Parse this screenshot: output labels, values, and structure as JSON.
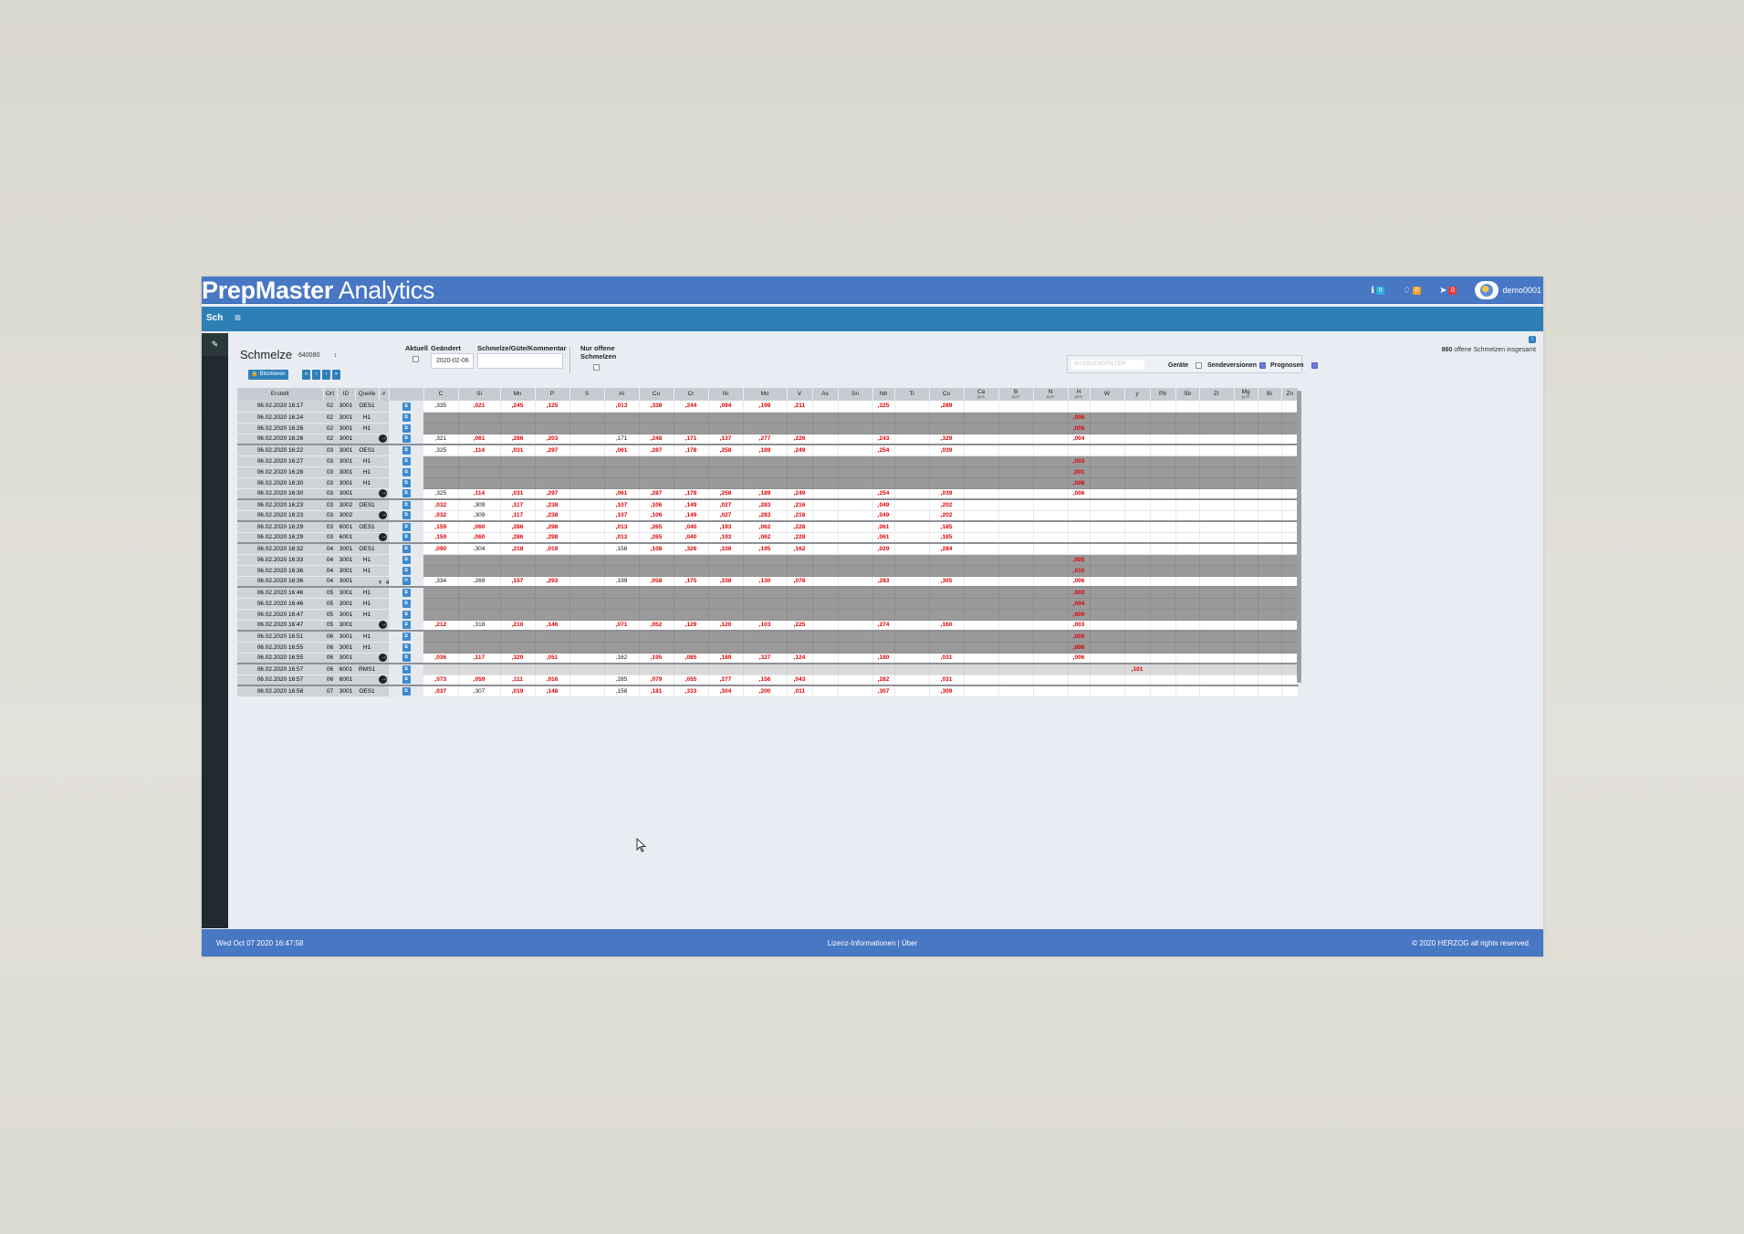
{
  "app": {
    "brand_bold": "PrepMaster",
    "brand_light": "Analytics"
  },
  "header": {
    "info_count": "0",
    "bell_count": "0",
    "alert_count": "0",
    "user": "demo0001"
  },
  "toolbar": {
    "tab": "Sch",
    "menu_icon": "≡"
  },
  "sidebar": {
    "button_icon": "✎"
  },
  "page": {
    "title": "Schmelze",
    "select_value": "640080",
    "block_button": "Blockieren",
    "pager": [
      "«",
      "‹",
      "›",
      "»"
    ],
    "aktuell": "Aktuell",
    "geaendert": "Geändert",
    "geaendert_value": "2020-02-06",
    "kommentar": "Schmelze/Güte/Kommentar",
    "nur_offene_1": "Nur offene",
    "nur_offene_2": "Schmelzen",
    "total_count": "860",
    "total_text": "offene Schmelzen insgesamt",
    "filter_placeholder": "AUSBLENDFILTER",
    "geraete": "Geräte",
    "sendeversionen": "Sendeversionen",
    "prognosen": "Prognosen"
  },
  "table": {
    "fixed_headers": [
      "Erstellt",
      "Ort",
      "ID",
      "Quelle",
      "#"
    ],
    "elements": [
      [
        "C",
        ""
      ],
      [
        "Si",
        ""
      ],
      [
        "Mn",
        ""
      ],
      [
        "P",
        ""
      ],
      [
        "S",
        ""
      ],
      [
        "Al",
        ""
      ],
      [
        "Cu",
        ""
      ],
      [
        "Cr",
        ""
      ],
      [
        "Ni",
        ""
      ],
      [
        "Mo",
        ""
      ],
      [
        "V",
        ""
      ],
      [
        "As",
        ""
      ],
      [
        "Sn",
        ""
      ],
      [
        "Nb",
        ""
      ],
      [
        "Ti",
        ""
      ],
      [
        "Co",
        ""
      ],
      [
        "Ca",
        "ppm"
      ],
      [
        "B",
        "ppm"
      ],
      [
        "N",
        "ppm"
      ],
      [
        "H",
        "ppm"
      ],
      [
        "W",
        ""
      ],
      [
        "y",
        ""
      ],
      [
        "Pb",
        ""
      ],
      [
        "Sb",
        ""
      ],
      [
        "Zr",
        ""
      ],
      [
        "Mg",
        "ppm"
      ],
      [
        "Bi",
        ""
      ],
      [
        "Zn",
        ""
      ]
    ],
    "rows": [
      {
        "d": "06.02.2020 16:17",
        "o": "02",
        "id": "3001",
        "q": "OES1",
        "n": "",
        "a": "",
        "t": "c",
        "v": {
          "0": ",335",
          "1": ",021",
          "2": ",245",
          "3": ",125",
          "5": ",013",
          "6": ",338",
          "7": ",244",
          "8": ",094",
          "9": ",199",
          "10": ",211",
          "13": ",325",
          "15": ",289"
        },
        "k": [
          0
        ]
      },
      {
        "d": "06.02.2020 16:24",
        "o": "02",
        "id": "3001",
        "q": "H1",
        "n": "",
        "a": "",
        "t": "g",
        "v": {
          "19": ",006"
        }
      },
      {
        "d": "06.02.2020 16:26",
        "o": "02",
        "id": "3001",
        "q": "H1",
        "n": "",
        "a": "",
        "t": "g",
        "v": {
          "19": ",005"
        }
      },
      {
        "d": "06.02.2020 16:26",
        "o": "02",
        "id": "3001",
        "q": "",
        "n": "4",
        "a": "arrow",
        "t": "c",
        "sep": true,
        "v": {
          "0": ",321",
          "1": ",061",
          "2": ",286",
          "3": ",203",
          "5": ",171",
          "6": ",248",
          "7": ",171",
          "8": ",137",
          "9": ",277",
          "10": ",226",
          "13": ",243",
          "15": ",329",
          "19": ",004"
        },
        "k": [
          0,
          5
        ]
      },
      {
        "d": "06.02.2020 16:22",
        "o": "03",
        "id": "3001",
        "q": "OES1",
        "n": "",
        "a": "",
        "t": "c",
        "v": {
          "0": ",325",
          "1": ",114",
          "2": ",031",
          "3": ",297",
          "5": ",061",
          "6": ",287",
          "7": ",178",
          "8": ",258",
          "9": ",189",
          "10": ",249",
          "13": ",254",
          "15": ",039"
        },
        "k": [
          0
        ]
      },
      {
        "d": "06.02.2020 16:27",
        "o": "03",
        "id": "3001",
        "q": "H1",
        "n": "",
        "a": "",
        "t": "g",
        "v": {
          "19": ",003"
        }
      },
      {
        "d": "06.02.2020 16:28",
        "o": "03",
        "id": "3001",
        "q": "H1",
        "n": "",
        "a": "",
        "t": "g",
        "v": {
          "19": ",001"
        }
      },
      {
        "d": "06.02.2020 16:30",
        "o": "03",
        "id": "3001",
        "q": "H1",
        "n": "",
        "a": "",
        "t": "g",
        "v": {
          "19": ",008"
        }
      },
      {
        "d": "06.02.2020 16:30",
        "o": "03",
        "id": "3001",
        "q": "",
        "n": "2",
        "a": "arrow",
        "t": "c",
        "sep": true,
        "v": {
          "0": ",325",
          "1": ",114",
          "2": ",031",
          "3": ",297",
          "5": ",061",
          "6": ",287",
          "7": ",178",
          "8": ",258",
          "9": ",189",
          "10": ",249",
          "13": ",254",
          "15": ",039",
          "19": ",006"
        },
        "k": [
          0
        ]
      },
      {
        "d": "06.02.2020 16:23",
        "o": "03",
        "id": "3002",
        "q": "OES1",
        "n": "",
        "a": "",
        "t": "c",
        "v": {
          "0": ",032",
          "1": ",309",
          "2": ",117",
          "3": ",238",
          "5": ",107",
          "6": ",106",
          "7": ",149",
          "8": ",027",
          "9": ",283",
          "10": ",216",
          "13": ",049",
          "15": ",202"
        },
        "k": [
          1
        ]
      },
      {
        "d": "06.02.2020 16:23",
        "o": "03",
        "id": "3002",
        "q": "",
        "n": "0",
        "a": "arrow",
        "t": "c",
        "sep": true,
        "v": {
          "0": ",032",
          "1": ",309",
          "2": ",117",
          "3": ",238",
          "5": ",107",
          "6": ",106",
          "7": ",149",
          "8": ",027",
          "9": ",283",
          "10": ",216",
          "13": ",049",
          "15": ",202"
        },
        "k": [
          1
        ]
      },
      {
        "d": "06.02.2020 16:29",
        "o": "03",
        "id": "6001",
        "q": "OES1",
        "n": "",
        "a": "",
        "t": "c",
        "v": {
          "0": ",159",
          "1": ",060",
          "2": ",286",
          "3": ",298",
          "5": ",013",
          "6": ",265",
          "7": ",040",
          "8": ",193",
          "9": ",062",
          "10": ",228",
          "13": ",061",
          "15": ",185"
        }
      },
      {
        "d": "06.02.2020 16:29",
        "o": "03",
        "id": "6001",
        "q": "",
        "n": "0",
        "a": "arrow",
        "t": "c",
        "sep": true,
        "v": {
          "0": ",159",
          "1": ",060",
          "2": ",286",
          "3": ",298",
          "5": ",013",
          "6": ",265",
          "7": ",040",
          "8": ",193",
          "9": ",062",
          "10": ",228",
          "13": ",061",
          "15": ",185"
        }
      },
      {
        "d": "06.02.2020 16:32",
        "o": "04",
        "id": "3001",
        "q": "OES1",
        "n": "",
        "a": "",
        "t": "c",
        "v": {
          "0": ",090",
          "1": ",304",
          "2": ",218",
          "3": ",019",
          "5": ",156",
          "6": ",108",
          "7": ",326",
          "8": ",336",
          "9": ",195",
          "10": ",162",
          "13": ",029",
          "15": ",284"
        },
        "k": [
          1,
          5
        ]
      },
      {
        "d": "06.02.2020 16:33",
        "o": "04",
        "id": "3001",
        "q": "H1",
        "n": "",
        "a": "",
        "t": "g",
        "v": {
          "19": ",005"
        }
      },
      {
        "d": "06.02.2020 16:36",
        "o": "04",
        "id": "3001",
        "q": "H1",
        "n": "",
        "a": "",
        "t": "g",
        "v": {
          "19": ",010"
        }
      },
      {
        "d": "06.02.2020 16:36",
        "o": "04",
        "id": "3001",
        "q": "",
        "n": "4",
        "a": "chev",
        "t": "c",
        "sep": true,
        "mail": true,
        "v": {
          "0": ",334",
          "1": ",269",
          "2": ",157",
          "3": ",293",
          "5": ",199",
          "6": ",058",
          "7": ",175",
          "8": ",338",
          "9": ",130",
          "10": ",078",
          "13": ",283",
          "15": ",305",
          "19": ",006"
        },
        "k": [
          0,
          1,
          5
        ]
      },
      {
        "d": "06.02.2020 16:46",
        "o": "05",
        "id": "3001",
        "q": "H1",
        "n": "",
        "a": "",
        "t": "g",
        "v": {
          "19": ",002"
        }
      },
      {
        "d": "06.02.2020 16:46",
        "o": "05",
        "id": "3001",
        "q": "H1",
        "n": "",
        "a": "",
        "t": "g",
        "v": {
          "19": ",004"
        }
      },
      {
        "d": "06.02.2020 16:47",
        "o": "05",
        "id": "3001",
        "q": "H1",
        "n": "",
        "a": "",
        "t": "g",
        "v": {
          "19": ",009"
        }
      },
      {
        "d": "06.02.2020 16:47",
        "o": "05",
        "id": "3001",
        "q": "",
        "n": "2",
        "a": "arrow",
        "t": "c",
        "sep": true,
        "v": {
          "0": ",212",
          "1": ",318",
          "2": ",210",
          "3": ",146",
          "5": ",071",
          "6": ",052",
          "7": ",129",
          "8": ",120",
          "9": ",103",
          "10": ",225",
          "13": ",274",
          "15": ",160",
          "19": ",003"
        },
        "k": [
          1
        ]
      },
      {
        "d": "06.02.2020 16:51",
        "o": "06",
        "id": "3001",
        "q": "H1",
        "n": "",
        "a": "",
        "t": "g",
        "v": {
          "19": ",000"
        }
      },
      {
        "d": "06.02.2020 16:55",
        "o": "06",
        "id": "3001",
        "q": "H1",
        "n": "",
        "a": "",
        "t": "g",
        "v": {
          "19": ",006"
        }
      },
      {
        "d": "06.02.2020 16:55",
        "o": "06",
        "id": "3001",
        "q": "",
        "n": "4",
        "a": "arrow",
        "t": "c",
        "sep": true,
        "v": {
          "0": ",036",
          "1": ",117",
          "2": ",320",
          "3": ",051",
          "5": ",162",
          "6": ",195",
          "7": ",085",
          "8": ",189",
          "9": ",327",
          "10": ",124",
          "13": ",180",
          "15": ",031",
          "19": ",006"
        },
        "k": [
          5
        ]
      },
      {
        "d": "06.02.2020 16:57",
        "o": "06",
        "id": "6001",
        "q": "RMS1",
        "n": "",
        "a": "",
        "t": "lg",
        "v": {
          "21": ",101"
        }
      },
      {
        "d": "06.02.2020 16:57",
        "o": "06",
        "id": "6001",
        "q": "",
        "n": "0",
        "a": "arrow",
        "t": "c",
        "sep": true,
        "v": {
          "0": ",073",
          "1": ",059",
          "2": ",111",
          "3": ",016",
          "5": ",285",
          "6": ",079",
          "7": ",055",
          "8": ",277",
          "9": ",156",
          "10": ",043",
          "13": ",282",
          "15": ",031"
        },
        "k": [
          5
        ]
      },
      {
        "d": "06.02.2020 16:58",
        "o": "07",
        "id": "3001",
        "q": "OES1",
        "n": "",
        "a": "",
        "t": "c",
        "v": {
          "0": ",037",
          "1": ",307",
          "2": ",019",
          "3": ",148",
          "5": ",158",
          "6": ",181",
          "7": ",333",
          "8": ",304",
          "9": ",200",
          "10": ",011",
          "13": ",307",
          "15": ",309"
        },
        "k": [
          1,
          5
        ]
      }
    ]
  },
  "footer": {
    "datetime": "Wed Oct 07 2020 16:47:58",
    "license": "Lizenz-Informationen",
    "sep": "|",
    "about": "Über",
    "copyright": "© 2020 HERZOG all rights reserved"
  }
}
